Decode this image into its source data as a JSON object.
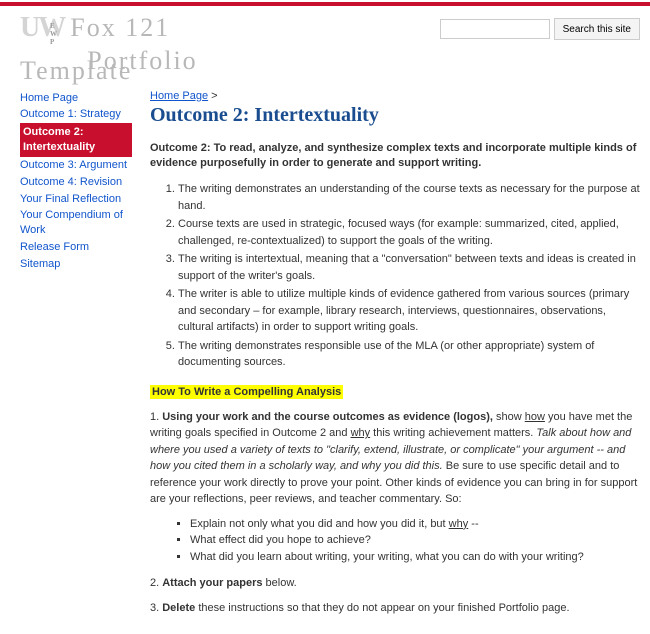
{
  "search": {
    "placeholder": "",
    "button": "Search this site"
  },
  "site": {
    "mark": "UW",
    "ewp": "E W P",
    "title_l1": "Fox 121",
    "title_l2": "Portfolio",
    "title_l3": "Template"
  },
  "sidebar": {
    "items": [
      {
        "label": "Home Page",
        "active": false
      },
      {
        "label": "Outcome 1: Strategy",
        "active": false
      },
      {
        "label": "Outcome 2: Intertextuality",
        "active": true
      },
      {
        "label": "Outcome 3: Argument",
        "active": false
      },
      {
        "label": "Outcome 4: Revision",
        "active": false
      },
      {
        "label": "Your Final Reflection",
        "active": false
      },
      {
        "label": "Your Compendium of Work",
        "active": false
      },
      {
        "label": "Release Form",
        "active": false
      },
      {
        "label": "Sitemap",
        "active": false
      }
    ]
  },
  "crumb": {
    "home": "Home Page",
    "sep": ">"
  },
  "page": {
    "title": "Outcome 2: Intertextuality",
    "stmt": "Outcome 2: To read, analyze, and synthesize complex texts and incorporate multiple kinds of evidence purposefully in order to generate and support writing.",
    "list": [
      "The writing demonstrates an understanding of the course texts as necessary for the purpose at hand.",
      "Course texts are used in strategic, focused ways (for example: summarized, cited, applied, challenged, re-contextualized) to support the goals of the writing.",
      "The writing is intertextual, meaning that a \"conversation\" between texts and ideas is created in support of the writer's goals.",
      "The writer is able to utilize multiple kinds of evidence gathered from various sources (primary and secondary – for example, library research, interviews, questionnaires, observations, cultural artifacts) in order to support writing goals.",
      "The writing demonstrates responsible use of the MLA (or other appropriate) system of documenting sources."
    ],
    "how_heading": "How To Write a Compelling Analysis",
    "p1_num": "1. ",
    "p1_bold": "Using your work and the course outcomes as evidence (logos),",
    "p1_a": " show ",
    "p1_how": "how",
    "p1_b": " you have met the writing goals specified in Outcome 2 and ",
    "p1_why": "why",
    "p1_c": " this writing achievement matters. ",
    "p1_em": "Talk about how and where you used a variety of texts to \"clarify, extend, illustrate, or complicate\" your argument -- and how you cited them in a scholarly way, and why you did this.",
    "p1_d": " Be sure to use specific detail and to reference your work directly to prove your point. Other kinds of evidence you can bring in for support are your reflections, peer reviews, and teacher commentary. So:",
    "bullets": [
      "Explain not only what you did and how you did it, but ",
      "What effect did you hope to achieve?",
      "What did you learn about writing, your writing, what you can do with your writing?"
    ],
    "b1_why": "why",
    "b1_tail": " --",
    "p2_num": "2. ",
    "p2_bold": "Attach your papers",
    "p2_tail": " below.",
    "p3_num": "3. ",
    "p3_bold": "Delete",
    "p3_tail": " these instructions so that they do not appear on your finished Portfolio page."
  }
}
